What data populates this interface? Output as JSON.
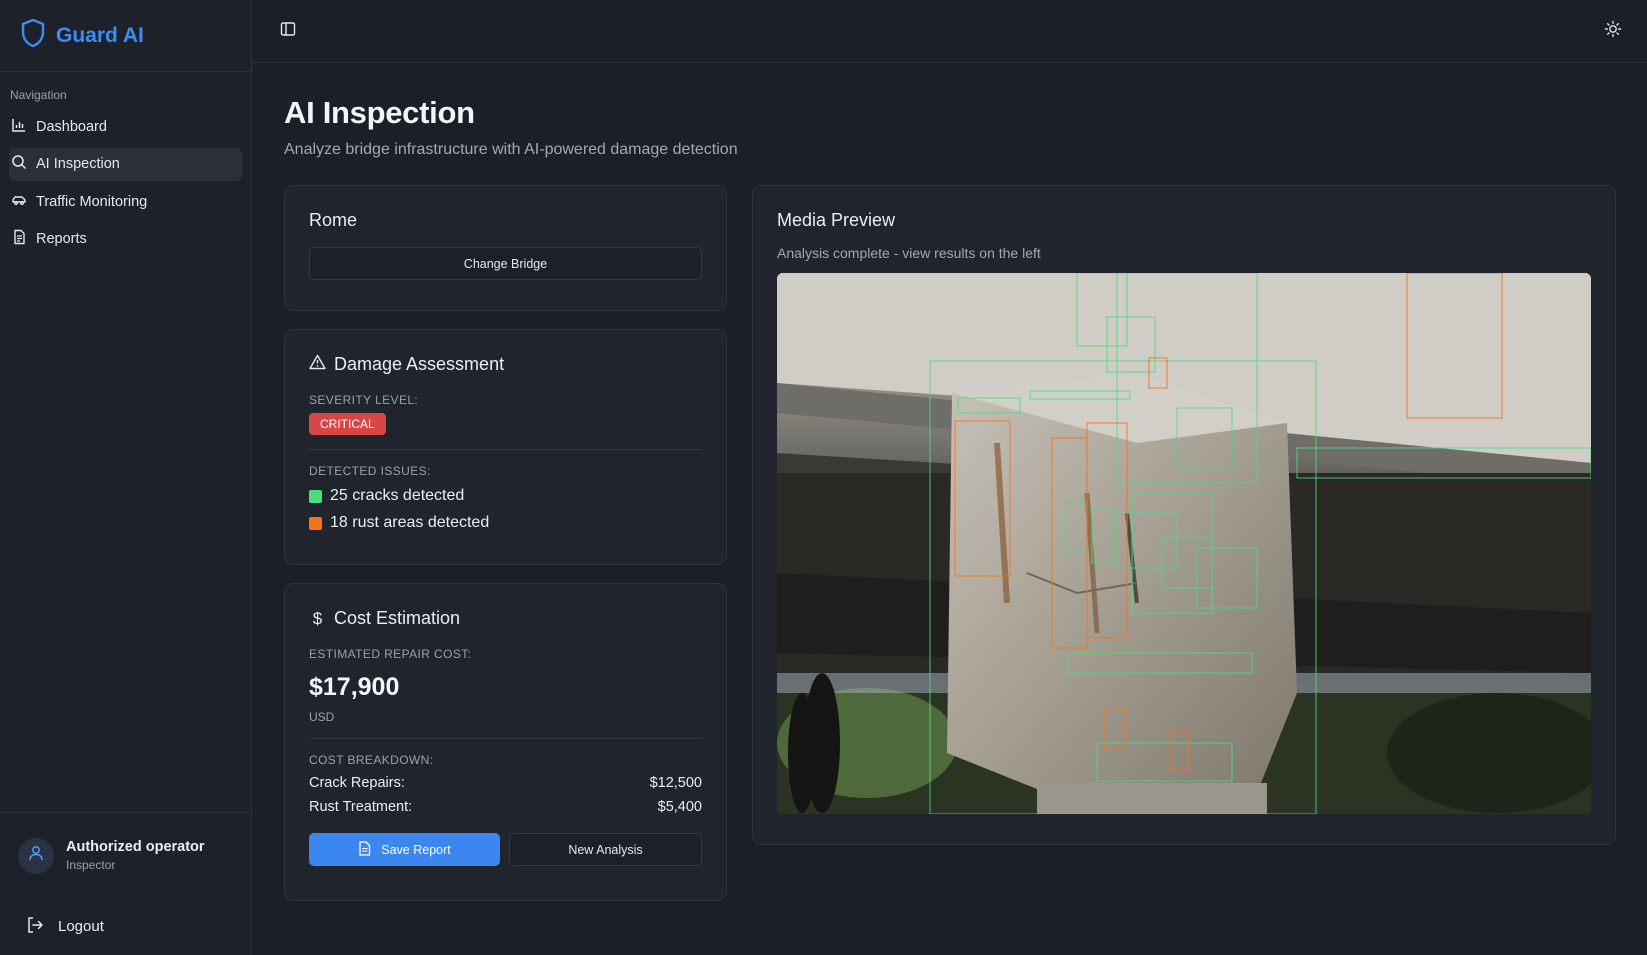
{
  "app": {
    "name": "Guard AI"
  },
  "sidebar": {
    "heading": "Navigation",
    "items": [
      {
        "label": "Dashboard",
        "icon": "bar-chart-icon"
      },
      {
        "label": "AI Inspection",
        "icon": "search-icon",
        "active": true
      },
      {
        "label": "Traffic Monitoring",
        "icon": "car-icon"
      },
      {
        "label": "Reports",
        "icon": "document-icon"
      }
    ],
    "user": {
      "name": "Authorized operator",
      "role": "Inspector"
    },
    "logout_label": "Logout"
  },
  "page": {
    "title": "AI Inspection",
    "subtitle": "Analyze bridge infrastructure with AI-powered damage detection"
  },
  "bridge_card": {
    "name": "Rome",
    "change_label": "Change Bridge"
  },
  "damage": {
    "title": "Damage Assessment",
    "severity_label": "SEVERITY LEVEL:",
    "severity_value": "CRITICAL",
    "issues_label": "DETECTED ISSUES:",
    "issues": [
      {
        "text": "25 cracks detected",
        "color": "#4ade80"
      },
      {
        "text": "18 rust areas detected",
        "color": "#f97316"
      }
    ]
  },
  "cost": {
    "title": "Cost Estimation",
    "estimate_label": "ESTIMATED REPAIR COST:",
    "total": "$17,900",
    "currency": "USD",
    "breakdown_label": "COST BREAKDOWN:",
    "breakdown": [
      {
        "label": "Crack Repairs:",
        "value": "$12,500"
      },
      {
        "label": "Rust Treatment:",
        "value": "$5,400"
      }
    ],
    "save_label": "Save Report",
    "new_label": "New Analysis"
  },
  "media": {
    "title": "Media Preview",
    "subtitle": "Analysis complete - view results on the left"
  },
  "colors": {
    "accent": "#3b86ef",
    "critical": "#d94646",
    "crack": "#4ade80",
    "rust": "#f97316"
  }
}
